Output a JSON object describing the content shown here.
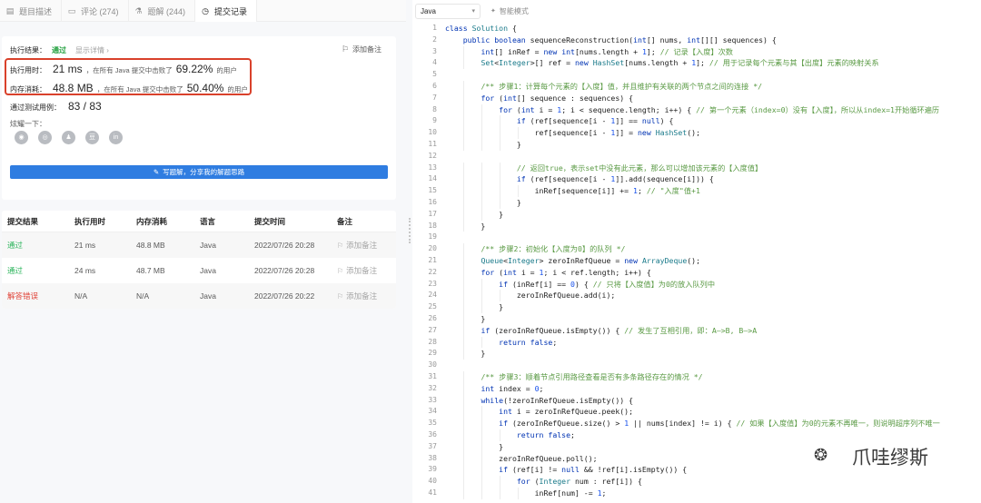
{
  "tabs": [
    {
      "label": "题目描述",
      "icon": "document-icon"
    },
    {
      "label": "评论 (274)",
      "icon": "comment-icon"
    },
    {
      "label": "题解 (244)",
      "icon": "flask-icon"
    },
    {
      "label": "提交记录",
      "icon": "clock-icon"
    }
  ],
  "result": {
    "label": "执行结果：",
    "status": "通过",
    "detail_link": "显示详情 ›",
    "add_note": "添加备注",
    "time_label": "执行用时：",
    "time_value": "21 ms",
    "time_desc": "，在所有 Java 提交中击败了",
    "time_pct": "69.22%",
    "time_suffix": "的用户",
    "mem_label": "内存消耗：",
    "mem_value": "48.8 MB",
    "mem_desc": "，在所有 Java 提交中击败了",
    "mem_pct": "50.40%",
    "mem_suffix": "的用户",
    "cases_label": "通过测试用例：",
    "cases_value": "83 / 83",
    "share_label": "炫耀一下：",
    "share_icons": [
      "wechat-icon",
      "weibo-icon",
      "qq-icon",
      "douban-icon",
      "linkedin-icon"
    ],
    "solution_button": "写题解，分享我的解题思路"
  },
  "submissions": {
    "headers": [
      "提交结果",
      "执行用时",
      "内存消耗",
      "语言",
      "提交时间",
      "备注"
    ],
    "rows": [
      {
        "status": "通过",
        "time": "21 ms",
        "memory": "48.8 MB",
        "lang": "Java",
        "submitted": "2022/07/26 20:28",
        "note": "添加备注"
      },
      {
        "status": "通过",
        "time": "24 ms",
        "memory": "48.7 MB",
        "lang": "Java",
        "submitted": "2022/07/26 20:28",
        "note": "添加备注"
      },
      {
        "status": "解答错误",
        "time": "N/A",
        "memory": "N/A",
        "lang": "Java",
        "submitted": "2022/07/26 20:22",
        "note": "添加备注"
      }
    ]
  },
  "editor": {
    "language": "Java",
    "smart_mode": "智能模式",
    "watermark": "爪哇缪斯",
    "lines": [
      "class Solution {",
      "    public boolean sequenceReconstruction(int[] nums, int[][] sequences) {",
      "        int[] inRef = new int[nums.length + 1]; // 记录【入度】次数",
      "        Set<Integer>[] ref = new HashSet[nums.length + 1]; // 用于记录每个元素与其【出度】元素的映射关系",
      "",
      "        /** 步骤1：计算每个元素的【入度】值，并且维护有关联的两个节点之间的连接 */",
      "        for (int[] sequence : sequences) {",
      "            for (int i = 1; i < sequence.length; i++) { // 第一个元素（index=0）没有【入度】，所以从index=1开始循环遍历",
      "                if (ref[sequence[i - 1]] == null) {",
      "                    ref[sequence[i - 1]] = new HashSet();",
      "                }",
      "",
      "                // 返回true，表示set中没有此元素，那么可以增加该元素的【入度值】",
      "                if (ref[sequence[i - 1]].add(sequence[i])) {",
      "                    inRef[sequence[i]] += 1; // \"入度\"值+1",
      "                }",
      "            }",
      "        }",
      "",
      "        /** 步骤2：初始化【入度为0】的队列 */",
      "        Queue<Integer> zeroInRefQueue = new ArrayDeque();",
      "        for (int i = 1; i < ref.length; i++) {",
      "            if (inRef[i] == 0) { // 只将【入度值】为0的放入队列中",
      "                zeroInRefQueue.add(i);",
      "            }",
      "        }",
      "        if (zeroInRefQueue.isEmpty()) { // 发生了互相引用，即：A—>B, B—>A",
      "            return false;",
      "        }",
      "",
      "        /** 步骤3：顺着节点引用路径查看是否有多条路径存在的情况 */",
      "        int index = 0;",
      "        while(!zeroInRefQueue.isEmpty()) {",
      "            int i = zeroInRefQueue.peek();",
      "            if (zeroInRefQueue.size() > 1 || nums[index] != i) { // 如果【入度值】为0的元素不再唯一，则说明超序列不唯一",
      "                return false;",
      "            }",
      "            zeroInRefQueue.poll();",
      "            if (ref[i] != null && !ref[i].isEmpty()) {",
      "                for (Integer num : ref[i]) {",
      "                    inRef[num] -= 1;"
    ]
  }
}
